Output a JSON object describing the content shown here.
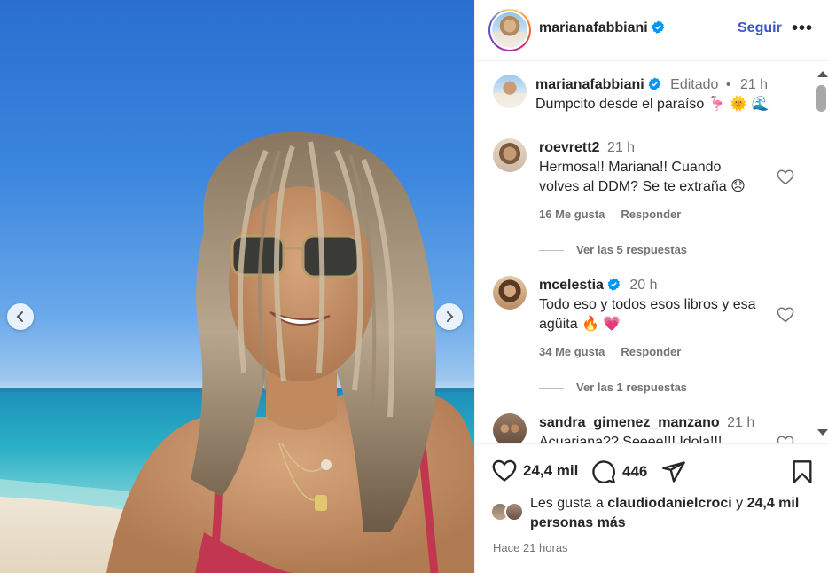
{
  "post": {
    "username": "marianafabbiani",
    "follow_label": "Seguir",
    "more_label": "•••"
  },
  "caption": {
    "username": "marianafabbiani",
    "edited": "Editado",
    "dot": "•",
    "time": "21 h",
    "text": "Dumpcito desde el paraíso 🦩 🌞 🌊"
  },
  "comments": [
    {
      "username": "roevrett2",
      "time": "21 h",
      "text": "Hermosa!! Mariana!! Cuando volves al DDM? Se te extraña 😞",
      "likes": "16 Me gusta",
      "reply_label": "Responder",
      "view_replies": "Ver las 5 respuestas"
    },
    {
      "username": "mcelestia",
      "time": "20 h",
      "text": "Todo eso y todos esos libros y esa agüita 🔥 💗",
      "likes": "34 Me gusta",
      "reply_label": "Responder",
      "view_replies": "Ver las 1 respuestas"
    },
    {
      "username": "sandra_gimenez_manzano",
      "time": "21 h",
      "text": "Acuariana?? Seeee!!! Idola!!!"
    }
  ],
  "actions": {
    "like_count": "24,4 mil",
    "comment_count": "446"
  },
  "likes_summary": {
    "prefix": "Les gusta a",
    "user": "claudiodanielcroci",
    "connector": "y",
    "others": "24,4 mil personas más"
  },
  "posted": "Hace 21 horas",
  "colors": {
    "accent_link": "#3b55c9",
    "verified": "#0095f6",
    "text": "#262626",
    "muted": "#737373"
  }
}
